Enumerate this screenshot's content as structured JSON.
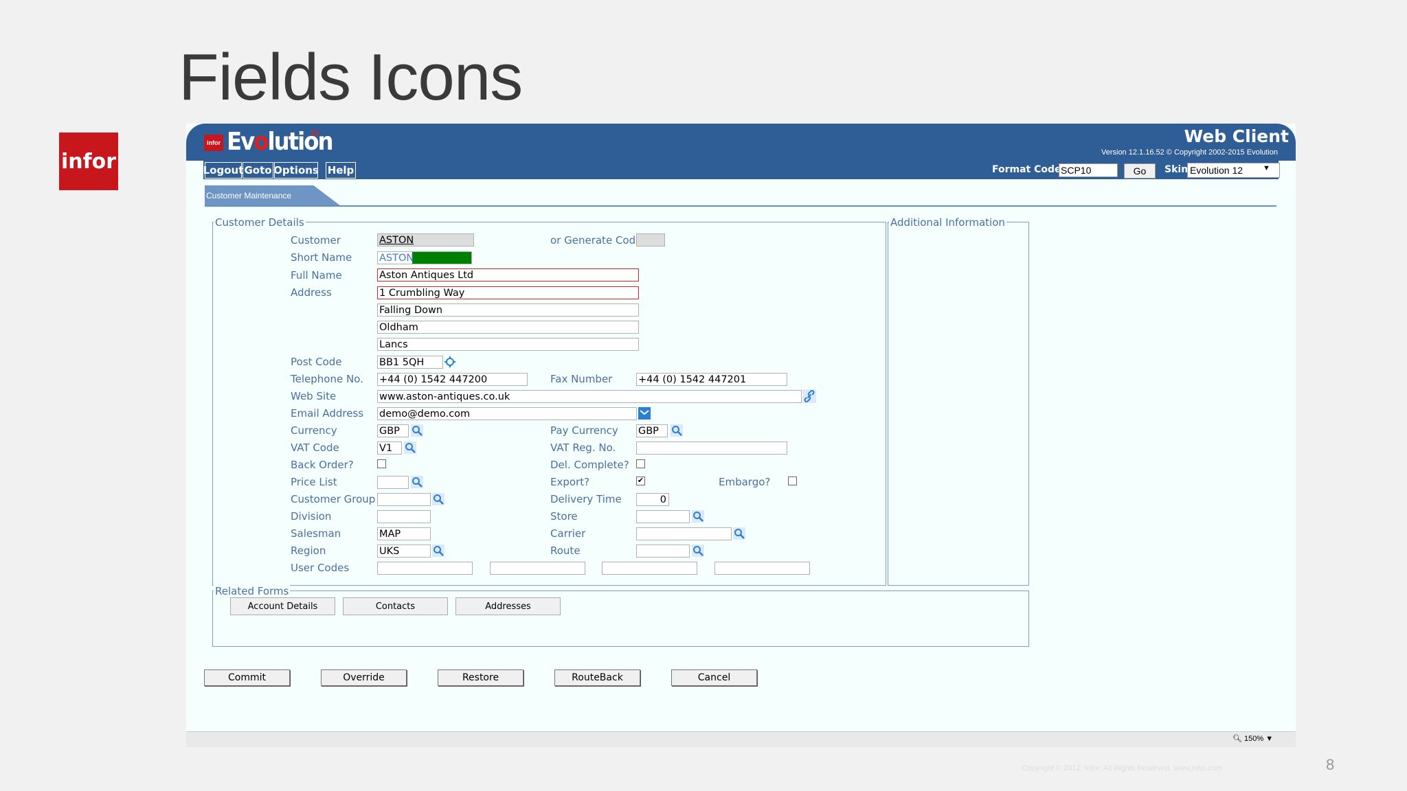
{
  "slide": {
    "title": "Fields Icons",
    "logo_text": "infor",
    "page_number": "8",
    "copyright": "Copyright © 2012. Infor. All Rights Reserved. www.infor.com"
  },
  "app": {
    "logo_badge": "infor",
    "logo_pre": "Ev",
    "logo_o": "o",
    "logo_post": "lution",
    "logo_sup": "12",
    "product": "Web Client",
    "version": "Version 12.1.16.52 © Copyright 2002-2015 Evolution"
  },
  "menu": {
    "logout": "Logout",
    "goto": "Goto",
    "options": "Options",
    "help": "Help"
  },
  "toolbar": {
    "format_code_label": "Format Code:",
    "format_code_value": "SCP10",
    "go": "Go",
    "skin_label": "Skin",
    "skin_value": "Evolution 12"
  },
  "tab": {
    "label": "Customer Maintenance"
  },
  "customer_details": {
    "legend": "Customer Details",
    "customer_label": "Customer",
    "customer_value": "ASTON",
    "generate_label": "or Generate Code",
    "short_name_label": "Short Name",
    "short_name_value": "ASTON",
    "full_name_label": "Full Name",
    "full_name_value": "Aston Antiques Ltd",
    "address_label": "Address",
    "address_lines": [
      "1 Crumbling Way",
      "Falling Down",
      "Oldham",
      "Lancs"
    ],
    "post_code_label": "Post Code",
    "post_code_value": "BB1 5QH",
    "telephone_label": "Telephone No.",
    "telephone_value": "+44 (0) 1542 447200",
    "fax_label": "Fax Number",
    "fax_value": "+44 (0) 1542 447201",
    "website_label": "Web Site",
    "website_value": "www.aston-antiques.co.uk",
    "email_label": "Email Address",
    "email_value": "demo@demo.com",
    "currency_label": "Currency",
    "currency_value": "GBP",
    "pay_currency_label": "Pay Currency",
    "pay_currency_value": "GBP",
    "vat_code_label": "VAT Code",
    "vat_code_value": "V1",
    "vat_reg_label": "VAT Reg. No.",
    "back_order_label": "Back Order?",
    "del_complete_label": "Del. Complete?",
    "price_list_label": "Price List",
    "export_label": "Export?",
    "export_checked": "✔",
    "embargo_label": "Embargo?",
    "customer_group_label": "Customer Group",
    "delivery_time_label": "Delivery Time",
    "delivery_time_value": "0",
    "division_label": "Division",
    "store_label": "Store",
    "salesman_label": "Salesman",
    "salesman_value": "MAP",
    "carrier_label": "Carrier",
    "region_label": "Region",
    "region_value": "UKS",
    "route_label": "Route",
    "user_codes_label": "User Codes"
  },
  "additional": {
    "legend": "Additional Information"
  },
  "related_forms": {
    "legend": "Related Forms",
    "buttons": [
      "Account Details",
      "Contacts",
      "Addresses"
    ]
  },
  "actions": {
    "buttons": [
      "Commit",
      "Override",
      "Restore",
      "RouteBack",
      "Cancel"
    ]
  },
  "status": {
    "zoom": "150%"
  },
  "colors": {
    "header": "#2f5e96",
    "label": "#4a6fa0",
    "short_name_fill": "#008000",
    "required_border": "#dd2222"
  }
}
